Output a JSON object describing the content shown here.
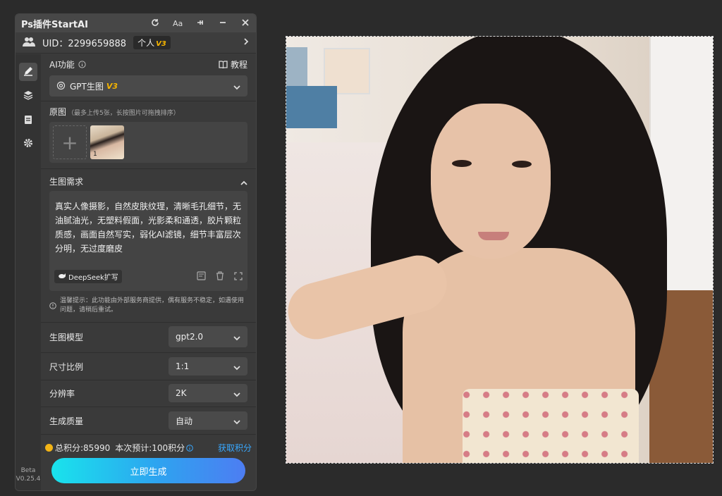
{
  "panel": {
    "title": "Ps插件StartAI",
    "uid_text": "UID：2299659888",
    "plan_label": "个人",
    "plan_version": "V3",
    "version_lines": [
      "Beta",
      "V0.25.4"
    ]
  },
  "ai_function": {
    "label": "AI功能",
    "tutorial": "教程",
    "selected": "GPT生图",
    "selected_version": "V3"
  },
  "source": {
    "label": "原图",
    "hint": "（最多上传5张，长按图片可拖拽排序）",
    "thumb_index": "1"
  },
  "requirements": {
    "label": "生图需求",
    "prompt": "真实人像摄影，自然皮肤纹理，清晰毛孔细节，无油腻油光，无塑料假面，光影柔和通透，胶片颗粒质感，画面自然写实，弱化AI滤镜，细节丰富层次分明，无过度磨皮",
    "deepseek_label": "DeepSeek扩写",
    "notice": "温馨提示：此功能由外部服务商提供，偶有服务不稳定，如遇使用问题，请稍后重试。"
  },
  "settings": [
    {
      "label": "生图模型",
      "value": "gpt2.0"
    },
    {
      "label": "尺寸比例",
      "value": "1:1"
    },
    {
      "label": "分辨率",
      "value": "2K"
    },
    {
      "label": "生成质量",
      "value": "自动"
    }
  ],
  "credits": {
    "total": "总积分:85990",
    "estimate": "本次预计:100积分",
    "get_label": "获取积分"
  },
  "generate_label": "立即生成",
  "colors": {
    "accent": "#2ea3f0",
    "version_gold": "#f5b400",
    "credit_gold": "#f2b416",
    "link": "#38a8ff"
  }
}
